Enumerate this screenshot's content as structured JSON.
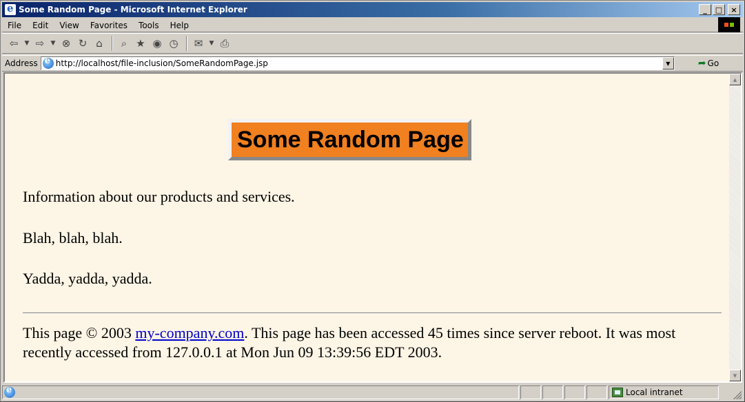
{
  "window": {
    "title": "Some Random Page - Microsoft Internet Explorer",
    "controls": {
      "minimize": "_",
      "maximize": "□",
      "close": "×"
    }
  },
  "menu": [
    "File",
    "Edit",
    "View",
    "Favorites",
    "Tools",
    "Help"
  ],
  "toolbar": {
    "icons": [
      "back-icon",
      "dropdown-icon",
      "forward-icon",
      "dropdown-icon",
      "stop-icon",
      "refresh-icon",
      "home-icon",
      "search-icon",
      "favorites-icon",
      "media-icon",
      "history-icon",
      "mail-icon",
      "print-icon"
    ]
  },
  "address": {
    "label": "Address",
    "url": "http://localhost/file-inclusion/SomeRandomPage.jsp",
    "go_label": "Go"
  },
  "page": {
    "heading": "Some Random Page",
    "paragraphs": [
      "Information about our products and services.",
      "Blah, blah, blah.",
      "Yadda, yadda, yadda."
    ],
    "footer": {
      "prefix": "This page © 2003 ",
      "link_text": "my-company.com",
      "suffix": ". This page has been accessed 45 times since server reboot. It was most recently accessed from 127.0.0.1 at Mon Jun 09 13:39:56 EDT 2003."
    }
  },
  "status": {
    "zone": "Local intranet"
  },
  "colors": {
    "page_background": "#fdf5e6",
    "heading_background": "#f08020",
    "link": "#0000cc",
    "chrome": "#d4d0c8",
    "titlebar_start": "#0a246a",
    "titlebar_end": "#a6caf0"
  }
}
